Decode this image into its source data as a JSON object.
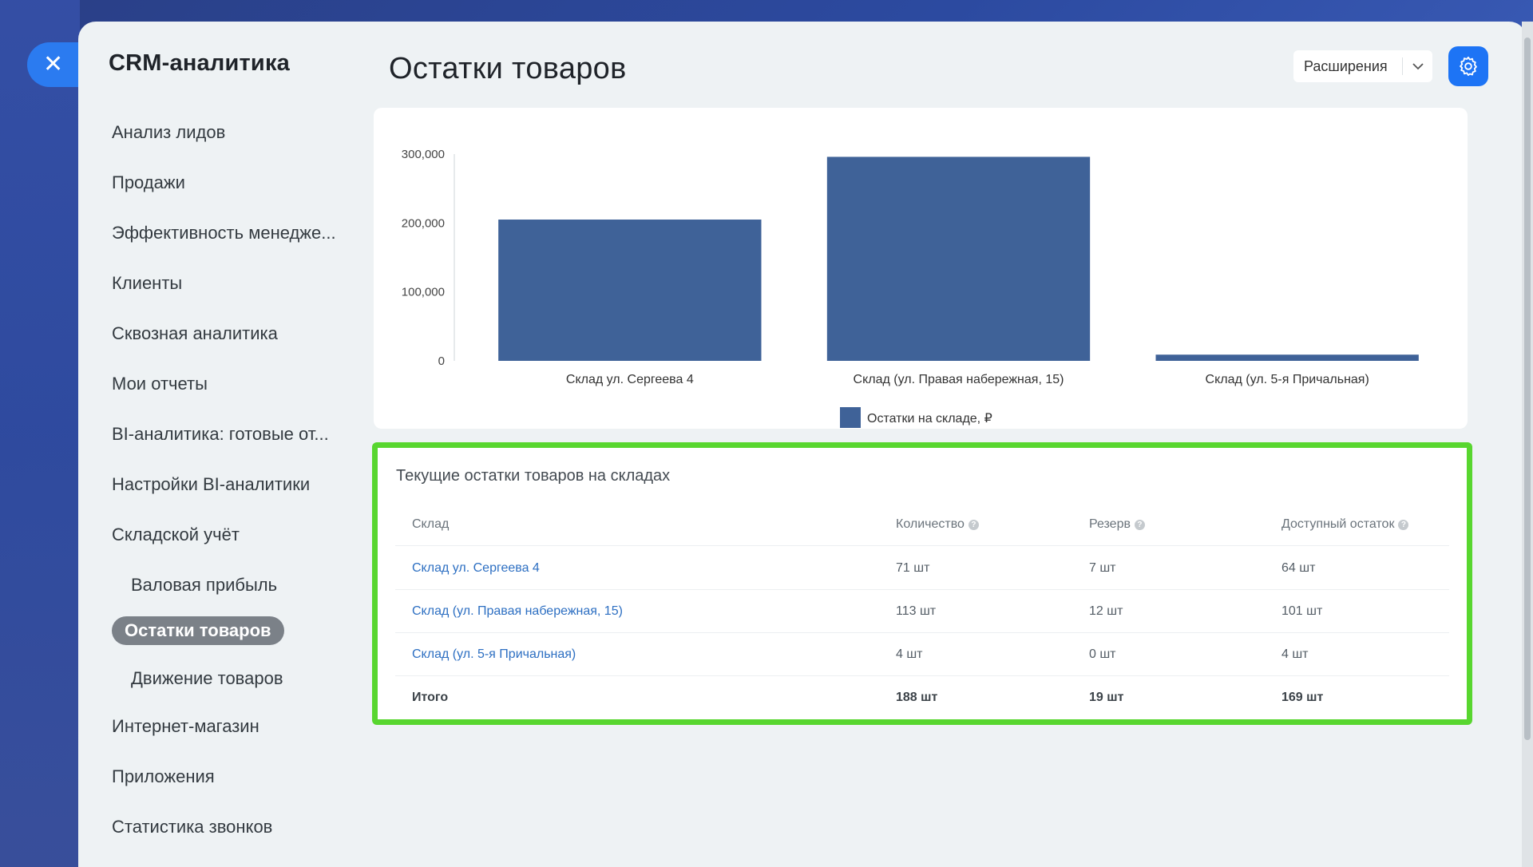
{
  "sidebar": {
    "title": "CRM-аналитика",
    "items": [
      {
        "label": "Анализ лидов"
      },
      {
        "label": "Продажи"
      },
      {
        "label": "Эффективность менедже..."
      },
      {
        "label": "Клиенты"
      },
      {
        "label": "Сквозная аналитика"
      },
      {
        "label": "Мои отчеты"
      },
      {
        "label": "BI-аналитика: готовые от..."
      },
      {
        "label": "Настройки BI-аналитики"
      },
      {
        "label": "Складской учёт"
      },
      {
        "label": "Валовая прибыль"
      },
      {
        "label": "Остатки товаров"
      },
      {
        "label": "Движение товаров"
      },
      {
        "label": "Интернет-магазин"
      },
      {
        "label": "Приложения"
      },
      {
        "label": "Статистика звонков"
      }
    ]
  },
  "header": {
    "title": "Остатки товаров",
    "extensions_label": "Расширения"
  },
  "icons": {
    "close": "close-icon",
    "gear": "gear-icon",
    "chevron": "chevron-down-icon",
    "help": "question-icon"
  },
  "colors": {
    "accent": "#1d74f5",
    "bar": "#3f6298",
    "highlight": "#58d62f",
    "link": "#2d6fc2"
  },
  "chart_data": {
    "type": "bar",
    "categories": [
      "Склад ул. Сергеева 4",
      "Склад (ул. Правая набережная, 15)",
      "Склад (ул. 5-я Причальная)"
    ],
    "series": [
      {
        "name": "Остатки на складе, ₽",
        "values": [
          205000,
          296000,
          9000
        ]
      }
    ],
    "yticks": [
      "0",
      "100,000",
      "200,000",
      "300,000"
    ],
    "ylim": [
      0,
      300000
    ],
    "legend_position": "bottom"
  },
  "table": {
    "title": "Текущие остатки товаров на складах",
    "columns": [
      "Склад",
      "Количество",
      "Резерв",
      "Доступный остаток"
    ],
    "help_mark": "?",
    "rows": [
      {
        "name": "Склад ул. Сергеева 4",
        "qty": "71 шт",
        "reserve": "7 шт",
        "available": "64 шт"
      },
      {
        "name": "Склад (ул. Правая набережная, 15)",
        "qty": "113 шт",
        "reserve": "12 шт",
        "available": "101 шт"
      },
      {
        "name": "Склад (ул. 5-я Причальная)",
        "qty": "4 шт",
        "reserve": "0 шт",
        "available": "4 шт"
      }
    ],
    "total": {
      "name": "Итого",
      "qty": "188 шт",
      "reserve": "19 шт",
      "available": "169 шт"
    }
  }
}
